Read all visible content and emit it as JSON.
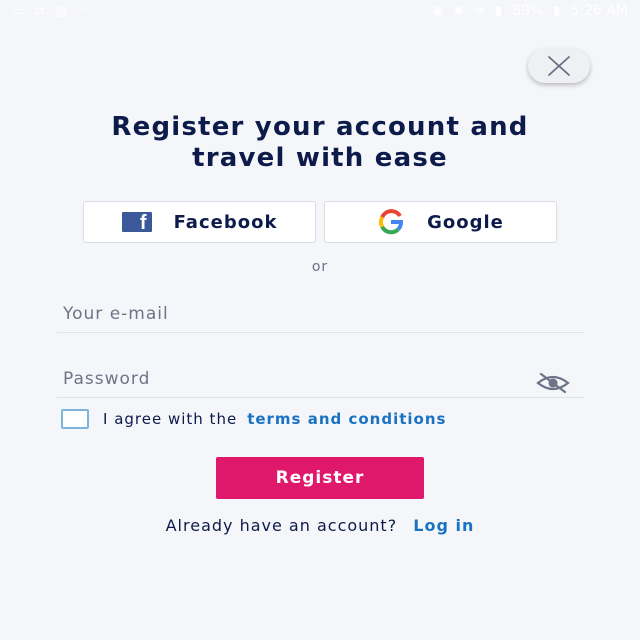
{
  "status_bar": {
    "left_icons": [
      "image-icon",
      "refresh-icon",
      "film-icon",
      "more-dots-icon"
    ],
    "right_icons": [
      "location-icon",
      "bluetooth-icon",
      "wifi-icon",
      "signal-icon",
      "battery-icon"
    ],
    "battery_percent": "89%",
    "time": "5:26 AM"
  },
  "close_button": {
    "icon": "close-icon"
  },
  "title": {
    "line1": "Register your account and",
    "line2": "travel with ease"
  },
  "social": {
    "facebook_label": "Facebook",
    "google_label": "Google"
  },
  "separator": "or",
  "form": {
    "email_placeholder": "Your e-mail",
    "email_value": "",
    "password_placeholder": "Password",
    "password_value": "",
    "agree_text": "I agree with the",
    "terms_link": "terms and conditions",
    "terms_checked": false,
    "register_label": "Register"
  },
  "login": {
    "prompt": "Already have an account?",
    "link": "Log in"
  },
  "colors": {
    "primary_button": "#e0186b",
    "link": "#1a73c2",
    "title": "#0d1b4b",
    "background": "#f5f6f9",
    "facebook": "#3b5998"
  }
}
